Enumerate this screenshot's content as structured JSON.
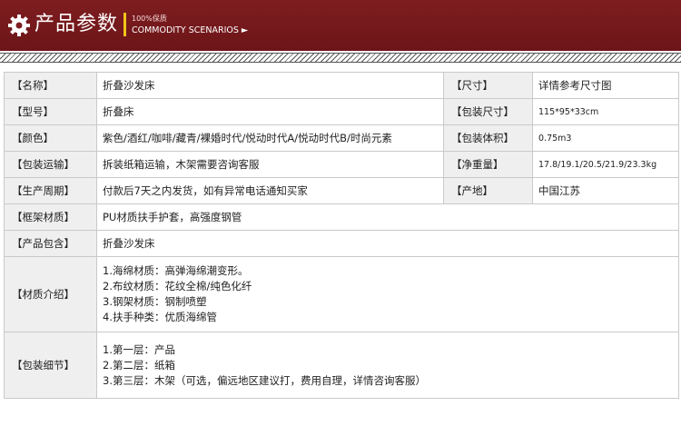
{
  "header": {
    "title": "产品参数",
    "sub_top": "100%保质",
    "sub_bottom": "COMMODITY SCENARIOS ►"
  },
  "rows": {
    "name": {
      "label": "【名称】",
      "value": "折叠沙发床",
      "label2": "【尺寸】",
      "value2": "详情参考尺寸图"
    },
    "model": {
      "label": "【型号】",
      "value": "折叠床",
      "label2": "【包装尺寸】",
      "value2": "115*95*33cm"
    },
    "color": {
      "label": "【颜色】",
      "value": "紫色/酒红/咖啡/藏青/裸婚时代/悦动时代A/悦动时代B/时尚元素",
      "label2": "【包装体积】",
      "value2": "0.75m3"
    },
    "shipping": {
      "label": "【包装运输】",
      "value": "拆装纸箱运输，木架需要咨询客服",
      "label2": "【净重量】",
      "value2": "17.8/19.1/20.5/21.9/23.3kg"
    },
    "cycle": {
      "label": "【生产周期】",
      "value": "付款后7天之内发货，如有异常电话通知买家",
      "label2": "【产地】",
      "value2": "中国江苏"
    },
    "frame": {
      "label": "【框架材质】",
      "value": "PU材质扶手护套，高强度钢管"
    },
    "includes": {
      "label": "【产品包含】",
      "value": "折叠沙发床"
    },
    "material": {
      "label": "【材质介绍】",
      "lines": [
        "1.海绵材质：高弹海绵潮变形。",
        "2.布纹材质：花纹全棉/纯色化纤",
        "3.钢架材质：钢制喷塑",
        "4.扶手种类：优质海绵管"
      ]
    },
    "packing": {
      "label": "【包装细节】",
      "lines": [
        "1.第一层：产品",
        "2.第二层：纸箱",
        "3.第三层：木架（可选，偏远地区建议打，费用自理，详情咨询客服）"
      ]
    }
  },
  "colors": {
    "banner": "#7e1d20",
    "accent_bar": "#f0c419",
    "label_bg": "#efefef",
    "border": "#c9c9c9"
  },
  "icons": {
    "header_icon": "gear-icon"
  }
}
